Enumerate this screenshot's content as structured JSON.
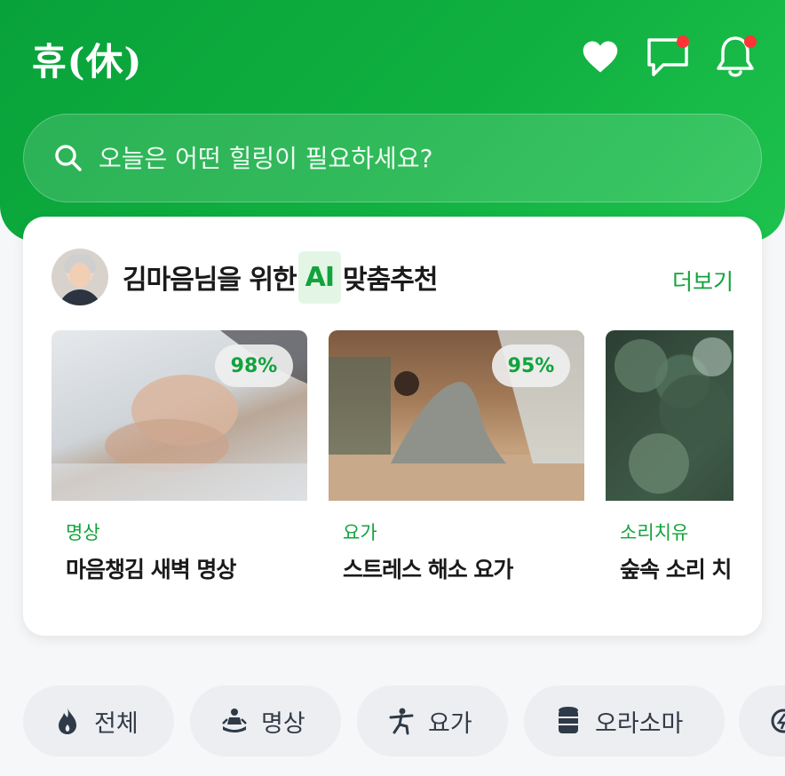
{
  "app": {
    "logo_text": "휴(休)"
  },
  "header": {
    "icons": [
      "heart-icon",
      "chat-icon",
      "bell-icon"
    ],
    "accent_color": "#12a33c",
    "notification_dot_color": "#ff3434"
  },
  "search": {
    "placeholder": "오늘은 어떤 힐링이 필요하세요?"
  },
  "recommend": {
    "title_prefix": "김마음님을 위한 ",
    "title_ai": "AI",
    "title_suffix": " 맞춤추천",
    "more_label": "더보기",
    "items": [
      {
        "match": "98%",
        "category": "명상",
        "title": "마음챙김 새벽 명상"
      },
      {
        "match": "95%",
        "category": "요가",
        "title": "스트레스 해소 요가"
      },
      {
        "match": "",
        "category": "소리치유",
        "title": "숲속 소리 치"
      }
    ]
  },
  "categories": [
    {
      "label": "전체",
      "icon": "fire-icon"
    },
    {
      "label": "명상",
      "icon": "meditation-icon"
    },
    {
      "label": "요가",
      "icon": "yoga-icon"
    },
    {
      "label": "오라소마",
      "icon": "bottles-icon"
    },
    {
      "label": "",
      "icon": "sound-icon"
    }
  ]
}
